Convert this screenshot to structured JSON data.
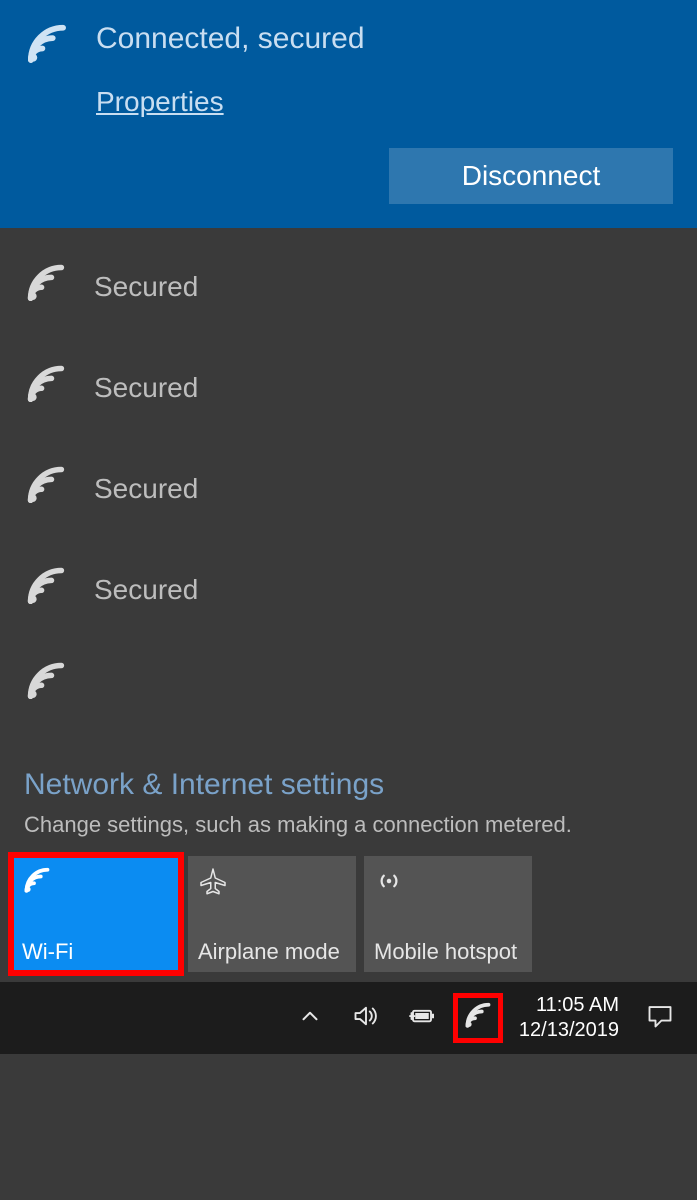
{
  "connected": {
    "status": "Connected, secured",
    "properties_label": "Properties",
    "disconnect_label": "Disconnect"
  },
  "networks": [
    {
      "status": "Secured"
    },
    {
      "status": "Secured"
    },
    {
      "status": "Secured"
    },
    {
      "status": "Secured"
    }
  ],
  "settings": {
    "title": "Network & Internet settings",
    "subtitle": "Change settings, such as making a connection metered."
  },
  "tiles": {
    "wifi": {
      "label": "Wi-Fi",
      "active": true
    },
    "airplane": {
      "label": "Airplane mode",
      "active": false
    },
    "hotspot": {
      "label": "Mobile hotspot",
      "active": false
    }
  },
  "taskbar": {
    "time": "11:05 AM",
    "date": "12/13/2019"
  }
}
